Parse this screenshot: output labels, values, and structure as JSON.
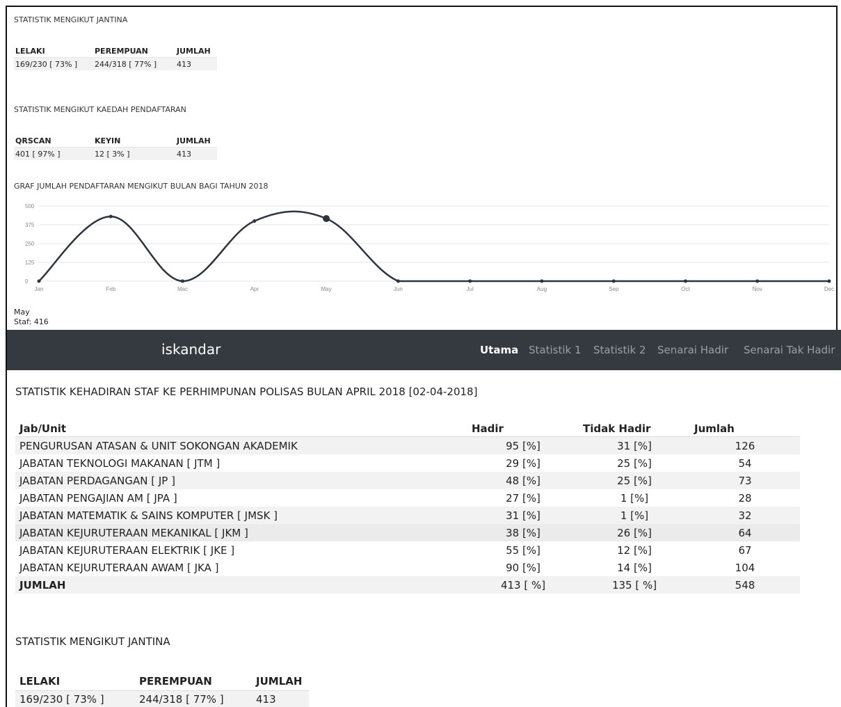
{
  "top_panel": {
    "gender_section_title": "STATISTIK MENGIKUT JANTINA",
    "gender_table": {
      "headers": [
        "LELAKI",
        "PEREMPUAN",
        "JUMLAH"
      ],
      "row": [
        "169/230 [ 73% ]",
        "244/318 [ 77% ]",
        "413"
      ]
    },
    "method_section_title": "STATISTIK MENGIKUT KAEDAH PENDAFTARAN",
    "method_table": {
      "headers": [
        "QRSCAN",
        "KEYIN",
        "JUMLAH"
      ],
      "row": [
        "401 [ 97% ]",
        "12 [ 3% ]",
        "413"
      ]
    },
    "chart_title": "GRAF JUMLAH PENDAFTARAN MENGIKUT BULAN BAGI TAHUN 2018",
    "tooltip": {
      "month": "May",
      "value_line": "Staf: 416"
    }
  },
  "chart_data": {
    "type": "line",
    "title": "GRAF JUMLAH PENDAFTARAN MENGIKUT BULAN BAGI TAHUN 2018",
    "categories": [
      "Jan",
      "Feb",
      "Mac",
      "Apr",
      "May",
      "Jun",
      "Jul",
      "Aug",
      "Sep",
      "Oct",
      "Nov",
      "Dec"
    ],
    "series": [
      {
        "name": "Staf",
        "values": [
          0,
          430,
          0,
          400,
          416,
          0,
          0,
          0,
          0,
          0,
          0,
          0
        ]
      }
    ],
    "yticks": [
      0,
      125,
      250,
      375,
      500
    ],
    "ylim": [
      0,
      500
    ],
    "grid": true,
    "highlight_index": 4,
    "line_color": "#2b3440"
  },
  "navbar": {
    "brand": "iskandar",
    "items": [
      {
        "label": "Utama",
        "active": true
      },
      {
        "label": "Statistik 1",
        "active": false
      },
      {
        "label": "Statistik 2",
        "active": false
      },
      {
        "label": "Senarai Hadir",
        "active": false
      },
      {
        "label": "Senarai Tak Hadir",
        "active": false
      }
    ]
  },
  "main": {
    "title": "STATISTIK KEHADIRAN STAF KE PERHIMPUNAN POLISAS BULAN APRIL 2018 [02-04-2018]",
    "table": {
      "headers": [
        "Jab/Unit",
        "Hadir",
        "Tidak Hadir",
        "Jumlah"
      ],
      "rows": [
        [
          "PENGURUSAN ATASAN & UNIT SOKONGAN AKADEMIK",
          "95 [%]",
          "31 [%]",
          "126"
        ],
        [
          "JABATAN TEKNOLOGI MAKANAN [ JTM ]",
          "29 [%]",
          "25 [%]",
          "54"
        ],
        [
          "JABATAN PERDAGANGAN [ JP ]",
          "48 [%]",
          "25 [%]",
          "73"
        ],
        [
          "JABATAN PENGAJIAN AM [ JPA ]",
          "27 [%]",
          "1 [%]",
          "28"
        ],
        [
          "JABATAN MATEMATIK & SAINS KOMPUTER [ JMSK ]",
          "31 [%]",
          "1 [%]",
          "32"
        ],
        [
          "JABATAN KEJURUTERAAN MEKANIKAL [ JKM ]",
          "38 [%]",
          "26 [%]",
          "64"
        ],
        [
          "JABATAN KEJURUTERAAN ELEKTRIK [ JKE ]",
          "55 [%]",
          "12 [%]",
          "67"
        ],
        [
          "JABATAN KEJURUTERAAN AWAM [ JKA ]",
          "90 [%]",
          "14 [%]",
          "104"
        ]
      ],
      "total": [
        "JUMLAH",
        "413 [ %]",
        "135 [ %]",
        "548"
      ]
    },
    "gender_title": "STATISTIK MENGIKUT JANTINA",
    "gender_table": {
      "headers": [
        "LELAKI",
        "PEREMPUAN",
        "JUMLAH"
      ],
      "row": [
        "169/230 [ 73% ]",
        "244/318 [ 77% ]",
        "413"
      ]
    }
  }
}
